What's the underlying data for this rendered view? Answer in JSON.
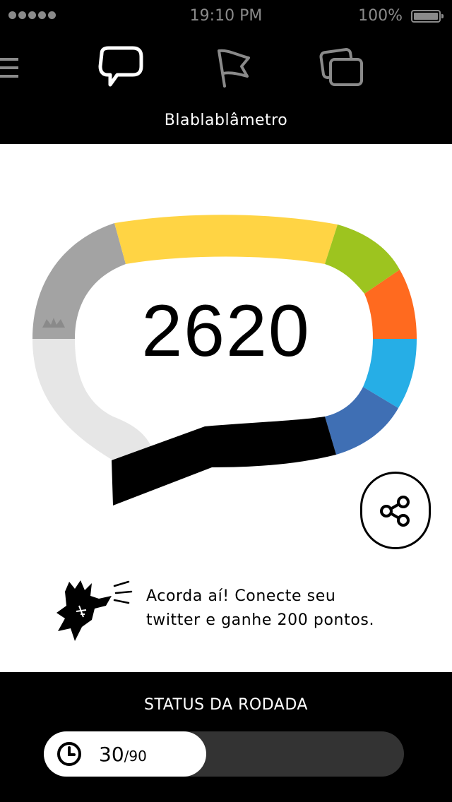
{
  "status_bar": {
    "time": "19:10 PM",
    "battery": "100%"
  },
  "nav": {
    "items": [
      {
        "icon": "speech-bubble-icon",
        "active": true
      },
      {
        "icon": "flag-icon",
        "active": false
      },
      {
        "icon": "cards-icon",
        "active": false
      }
    ]
  },
  "header": {
    "title": "Blablablâmetro"
  },
  "meter": {
    "score": "2620",
    "segment_colors": [
      "#e6e6e6",
      "#a3a3a3",
      "#ffd444",
      "#9dc41f",
      "#ff6a1f",
      "#26aee6",
      "#3f6fb4",
      "#000000"
    ]
  },
  "promo": {
    "line1": "Acorda aí! Conecte seu",
    "line2": "twitter e ganhe 200 pontos."
  },
  "round": {
    "title": "STATUS DA RODADA",
    "current": "30",
    "total": "/90",
    "progress": 0.33
  }
}
